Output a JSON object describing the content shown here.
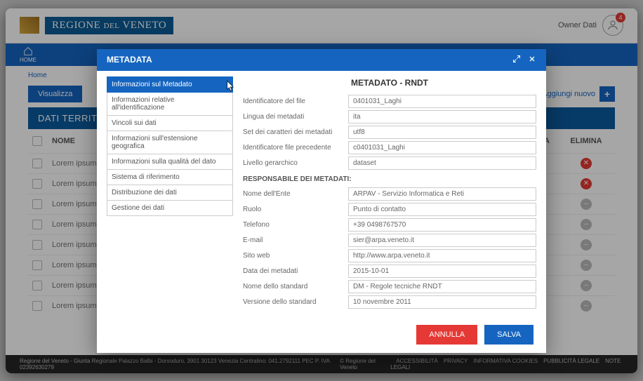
{
  "brand": {
    "prefix": "REGIONE",
    "mid": "DEL",
    "suffix": "VENETO"
  },
  "user": {
    "name": "Owner Dati",
    "notifications": "4"
  },
  "nav": {
    "home": "HOME"
  },
  "breadcrumb": "Home",
  "toolbar": {
    "visualizza": "Visualizza",
    "add_new": "Aggiungi nuovo"
  },
  "section_title": "DATI TERRITORIALI",
  "table": {
    "col_name": "NOME",
    "col_ca": "CA",
    "col_delete": "ELIMINA",
    "rows": [
      {
        "name": "Lorem ipsum",
        "del": "red"
      },
      {
        "name": "Lorem ipsum",
        "del": "red"
      },
      {
        "name": "Lorem ipsum",
        "del": "grey"
      },
      {
        "name": "Lorem ipsum",
        "del": "grey"
      },
      {
        "name": "Lorem ipsum",
        "del": "grey"
      },
      {
        "name": "Lorem ipsum",
        "del": "grey"
      },
      {
        "name": "Lorem ipsum",
        "del": "grey"
      },
      {
        "name": "Lorem ipsum",
        "del": "grey"
      }
    ]
  },
  "footer": {
    "left": "Regione del Veneto - Giunta Regionale  Palazzo Balbi - Dorsoduro, 3901  30123 Venezia  Centralino: 041.2792111 PEC P. IVA 02392630279",
    "center": "© Regione del Veneto",
    "links": [
      "ACCESSIBILITÀ",
      "PRIVACY",
      "INFORMATIVA COOKIES",
      "PUBBLICITÀ LEGALE",
      "NOTE LEGALI"
    ]
  },
  "modal": {
    "header": "METADATA",
    "title": "METADATO - RNDT",
    "menu": [
      "Informazioni sul Metadato",
      "Informazioni relative all'identificazione",
      "Vincoli sui dati",
      "Informazioni sull'estensione geografica",
      "Informazioni sulla qualità del dato",
      "Sistema di riferimento",
      "Distribuzione dei dati",
      "Gestione dei dati"
    ],
    "fields": [
      {
        "label": "Identificatore del file",
        "value": "0401031_Laghi"
      },
      {
        "label": "Lingua dei metadati",
        "value": "ita"
      },
      {
        "label": "Set dei caratteri dei metadati",
        "value": "utf8"
      },
      {
        "label": "Identificatore file precedente",
        "value": "c0401031_Laghi"
      },
      {
        "label": "Livello gerarchico",
        "value": "dataset"
      }
    ],
    "subheading": "RESPONSABILE DEI METADATI:",
    "fields2": [
      {
        "label": "Nome dell'Ente",
        "value": "ARPAV - Servizio Informatica e Reti"
      },
      {
        "label": "Ruolo",
        "value": "Punto di contatto"
      },
      {
        "label": "Telefono",
        "value": "+39 0498767570"
      },
      {
        "label": "E-mail",
        "value": "sier@arpa.veneto.it"
      },
      {
        "label": "Sito web",
        "value": "http://www.arpa.veneto.it"
      },
      {
        "label": "Data dei metadati",
        "value": "2015-10-01"
      },
      {
        "label": "Nome dello standard",
        "value": "DM - Regole tecniche RNDT"
      },
      {
        "label": "Versione dello standard",
        "value": "10 novembre 2011"
      }
    ],
    "buttons": {
      "cancel": "ANNULLA",
      "save": "SALVA"
    }
  }
}
